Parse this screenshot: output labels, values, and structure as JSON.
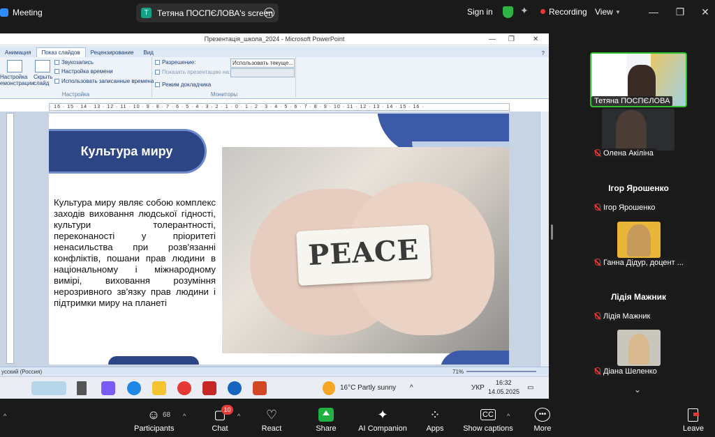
{
  "app": {
    "title": "Meeting",
    "brand_color": "#2d8cff"
  },
  "screen_share": {
    "presenter_initial": "T",
    "label": "Тетяна ПОСПЄЛОВА's screen"
  },
  "top_right": {
    "sign_in": "Sign in",
    "recording": "Recording",
    "view": "View"
  },
  "ppt": {
    "window_title": "Презентація_школа_2024 - Microsoft PowerPoint",
    "tabs": [
      "Анимация",
      "Показ слайдов",
      "Рецензирование",
      "Вид"
    ],
    "active_tab": "Показ слайдов",
    "ribbon": {
      "setup_btn": "Настройка\nемонстрации",
      "hide_btn": "Скрыть\nслайд",
      "record_narration": "Звукозапись",
      "rehearse": "Настройка времени",
      "use_timings": "Использовать записанные времена",
      "group_setup": "Настройка",
      "resolution_label": "Разрешение:",
      "resolution_value": "Использовать текуще...",
      "show_on": "Показать презентацию на:",
      "presenter_view": "Режим докладчика",
      "group_monitors": "Мониторы"
    },
    "ruler_text": "· 16 · 15 · 14 · 13 · 12 · 11 · 10 · 9 · 8 · 7 · 6 · 5 · 4 · 3 · 2 · 1 · 0 · 1 · 2 · 3 · 4 · 5 · 6 · 7 · 8 · 9 · 10 · 11 · 12 · 13 · 14 · 15 · 16 ·",
    "slide": {
      "heading": "Культура миру",
      "body": "Культура миру являє собою комплекс заходів виховання людської гідності, культури толерантності, переконаності у пріоритеті ненасильства при розв'язанні конфліктів, пошани прав людини в національному і міжнародному вимірі, виховання розуміння нерозривного зв'язку прав людини і підтримки миру на планеті",
      "photo_word": "PEACE"
    },
    "status_language": "усский (Россия)",
    "zoom": "71%"
  },
  "taskbar": {
    "weather": "16°C  Partly sunny",
    "lang": "УКР",
    "time": "16:32",
    "date": "14.05.2025"
  },
  "participants": [
    {
      "name": "Тетяна ПОСПЄЛОВА",
      "muted": false,
      "active": true
    },
    {
      "name": "Олена Акіліна",
      "muted": true
    },
    {
      "name": "Ігор Ярошенко",
      "muted": true,
      "big_name": "Ігор Ярошенко"
    },
    {
      "name": "Ганна Дідур, доцент ...",
      "muted": true
    },
    {
      "name": "Лідія Мажник",
      "muted": true,
      "big_name": "Лідія Мажник"
    },
    {
      "name": "Діана Шеленко",
      "muted": true
    }
  ],
  "toolbar": {
    "participants": "Participants",
    "participants_count": "68",
    "chat": "Chat",
    "chat_badge": "10",
    "react": "React",
    "share": "Share",
    "ai": "AI Companion",
    "apps": "Apps",
    "captions": "Show captions",
    "more": "More",
    "leave": "Leave"
  }
}
